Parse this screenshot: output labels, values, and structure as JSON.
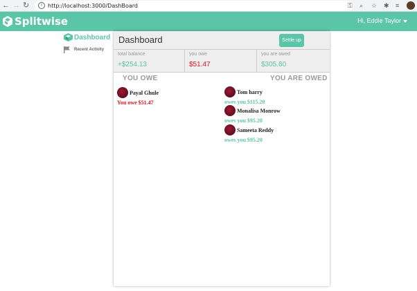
{
  "browser": {
    "url": "http://localhost:3000/DashBoard"
  },
  "app": {
    "brand": "Splitwise",
    "greeting": "Hi, Eddie Taylor",
    "colors": {
      "accent": "#5bc5a7",
      "owe": "#e4141c",
      "owed": "#5bc5a7"
    }
  },
  "nav": {
    "dashboard": "Dashboard",
    "recent": "Recent Activity"
  },
  "dashboard": {
    "title": "Dashboard",
    "settle_label": "Settle up",
    "balances": {
      "total_label": "total balance",
      "total_value": "+$254.13",
      "owe_label": "you owe",
      "owe_value": "$51.47",
      "owed_label": "you are owed",
      "owed_value": "$305.60"
    },
    "you_owe_heading": "YOU OWE",
    "you_are_owed_heading": "YOU ARE OWED",
    "you_owe": [
      {
        "name": "Payal Ghule",
        "amount": "You owe $51.47"
      }
    ],
    "you_are_owed": [
      {
        "name": "Tom harry",
        "amount": "owes you $115.20"
      },
      {
        "name": "Monalisa Monrow",
        "amount": "owes you $95.20"
      },
      {
        "name": "Sameeta Reddy",
        "amount": "owes you $95.20"
      }
    ]
  }
}
